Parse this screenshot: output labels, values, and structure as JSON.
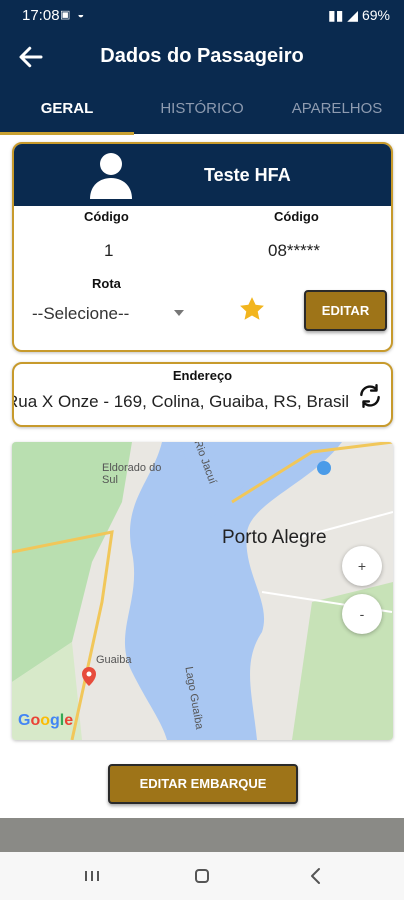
{
  "status": {
    "time": "17:08",
    "left_icons": "▣ ◒",
    "right": "69%"
  },
  "appbar": {
    "title": "Dados do Passageiro",
    "back_icon": "back-arrow-icon"
  },
  "tabs": [
    {
      "label": "GERAL",
      "active": true
    },
    {
      "label": "HISTÓRICO",
      "active": false
    },
    {
      "label": "APARELHOS",
      "active": false
    }
  ],
  "passenger": {
    "name": "Teste HFA",
    "code_label_1": "Código",
    "code_value_1": "1",
    "code_label_2": "Código",
    "code_value_2": "08*****",
    "route_label": "Rota",
    "route_select": "--Selecione--",
    "edit_button": "EDITAR"
  },
  "address": {
    "label": "Endereço",
    "value": "Rua X Onze - 169, Colina, Guaiba, RS, Brasil"
  },
  "map": {
    "city": "Porto Alegre",
    "labels": [
      "Eldorado do Sul",
      "Rio Jacuí",
      "Guaiba",
      "Lago Guaíba"
    ],
    "zoom_in": "+",
    "zoom_out": "-",
    "brand": "Google"
  },
  "actions": {
    "edit_boarding": "EDITAR EMBARQUE"
  },
  "colors": {
    "primary": "#0a2a4f",
    "accent": "#c79a2c",
    "button": "#9e7418"
  }
}
